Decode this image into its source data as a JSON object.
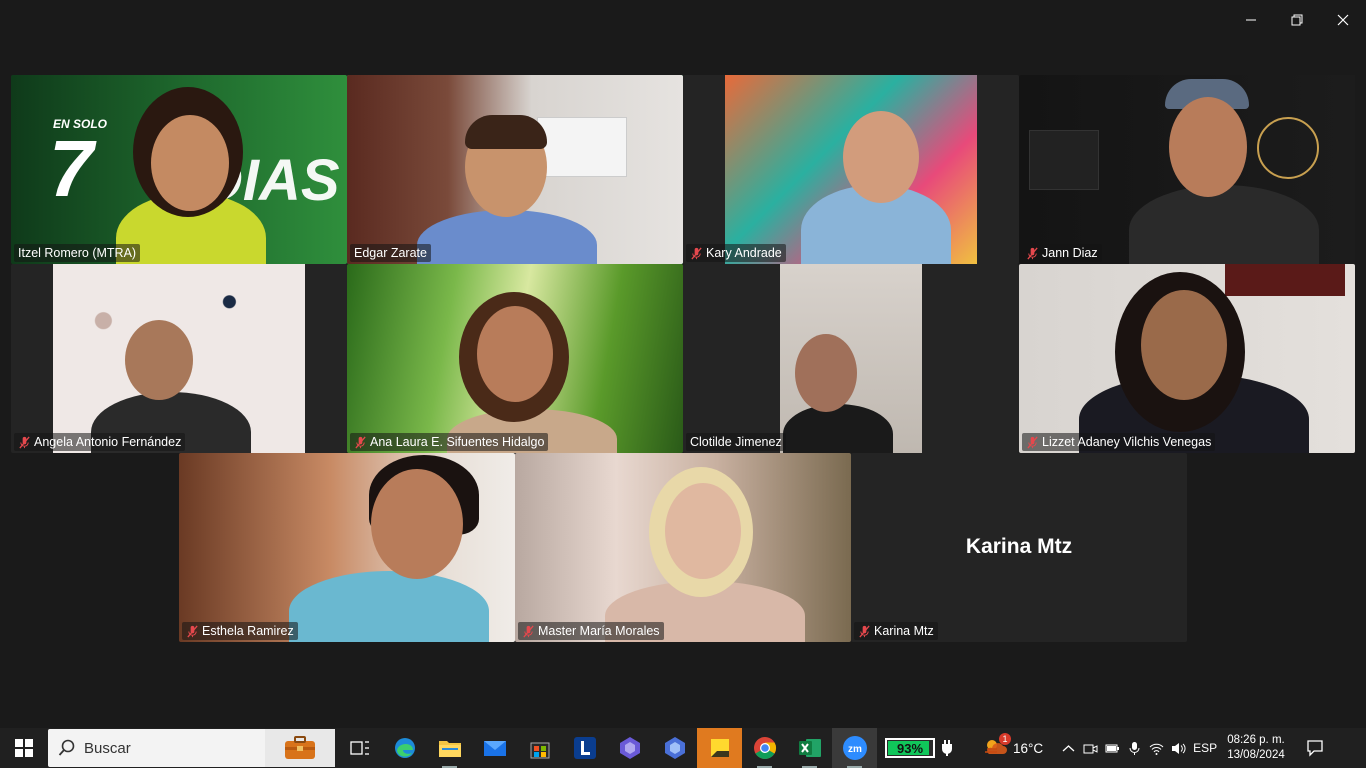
{
  "window": {
    "controls": [
      "minimize-icon",
      "restore-icon",
      "close-icon"
    ]
  },
  "participants": [
    {
      "name": "Itzel Romero (MTRA)",
      "muted": false,
      "bg_text_1": "EN SOLO",
      "bg_text_2": "7",
      "bg_text_3": "DIAS"
    },
    {
      "name": "Edgar Zarate",
      "muted": false,
      "active_speaker": true
    },
    {
      "name": "Kary Andrade",
      "muted": true
    },
    {
      "name": "Jann Diaz",
      "muted": true
    },
    {
      "name": "Angela Antonio Fernández",
      "muted": true
    },
    {
      "name": "Ana Laura E. Sifuentes Hidalgo",
      "muted": true
    },
    {
      "name": "Clotilde Jimenez",
      "muted": false
    },
    {
      "name": "Lizzet Adaney Vilchis Venegas",
      "muted": true
    },
    {
      "name": "Esthela Ramirez",
      "muted": true
    },
    {
      "name": "Master María Morales",
      "muted": true
    },
    {
      "name": "Karina Mtz",
      "muted": true,
      "video_off": true,
      "display_name": "Karina Mtz"
    }
  ],
  "taskbar": {
    "search_placeholder": "Buscar",
    "apps": [
      "task-view-icon",
      "edge-icon",
      "file-explorer-icon",
      "mail-icon",
      "store-icon",
      "l-app-icon",
      "copilot-icon",
      "copilot-alt-icon",
      "sticky-notes-icon",
      "chrome-icon",
      "excel-icon",
      "zoom-icon"
    ],
    "battery_percent": "93%",
    "battery_level": 0.93,
    "temperature": "16°C",
    "weather_badge": "1",
    "language": "ESP",
    "time": "08:26 p. m.",
    "date": "13/08/2024"
  },
  "colors": {
    "active_speaker_border": "#2ecc71",
    "muted_icon": "#e5484d",
    "battery_fill": "#10c65a",
    "window_bg": "#1a1a1a"
  }
}
